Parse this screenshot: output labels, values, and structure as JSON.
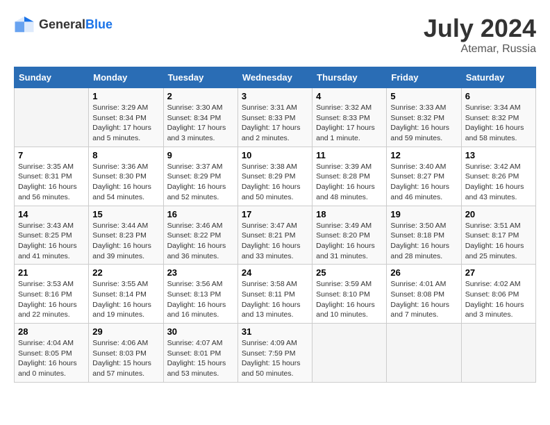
{
  "header": {
    "logo_general": "General",
    "logo_blue": "Blue",
    "month_year": "July 2024",
    "location": "Atemar, Russia"
  },
  "columns": [
    "Sunday",
    "Monday",
    "Tuesday",
    "Wednesday",
    "Thursday",
    "Friday",
    "Saturday"
  ],
  "weeks": [
    [
      {
        "day": "",
        "sunrise": "",
        "sunset": "",
        "daylight": ""
      },
      {
        "day": "1",
        "sunrise": "Sunrise: 3:29 AM",
        "sunset": "Sunset: 8:34 PM",
        "daylight": "Daylight: 17 hours and 5 minutes."
      },
      {
        "day": "2",
        "sunrise": "Sunrise: 3:30 AM",
        "sunset": "Sunset: 8:34 PM",
        "daylight": "Daylight: 17 hours and 3 minutes."
      },
      {
        "day": "3",
        "sunrise": "Sunrise: 3:31 AM",
        "sunset": "Sunset: 8:33 PM",
        "daylight": "Daylight: 17 hours and 2 minutes."
      },
      {
        "day": "4",
        "sunrise": "Sunrise: 3:32 AM",
        "sunset": "Sunset: 8:33 PM",
        "daylight": "Daylight: 17 hours and 1 minute."
      },
      {
        "day": "5",
        "sunrise": "Sunrise: 3:33 AM",
        "sunset": "Sunset: 8:32 PM",
        "daylight": "Daylight: 16 hours and 59 minutes."
      },
      {
        "day": "6",
        "sunrise": "Sunrise: 3:34 AM",
        "sunset": "Sunset: 8:32 PM",
        "daylight": "Daylight: 16 hours and 58 minutes."
      }
    ],
    [
      {
        "day": "7",
        "sunrise": "Sunrise: 3:35 AM",
        "sunset": "Sunset: 8:31 PM",
        "daylight": "Daylight: 16 hours and 56 minutes."
      },
      {
        "day": "8",
        "sunrise": "Sunrise: 3:36 AM",
        "sunset": "Sunset: 8:30 PM",
        "daylight": "Daylight: 16 hours and 54 minutes."
      },
      {
        "day": "9",
        "sunrise": "Sunrise: 3:37 AM",
        "sunset": "Sunset: 8:29 PM",
        "daylight": "Daylight: 16 hours and 52 minutes."
      },
      {
        "day": "10",
        "sunrise": "Sunrise: 3:38 AM",
        "sunset": "Sunset: 8:29 PM",
        "daylight": "Daylight: 16 hours and 50 minutes."
      },
      {
        "day": "11",
        "sunrise": "Sunrise: 3:39 AM",
        "sunset": "Sunset: 8:28 PM",
        "daylight": "Daylight: 16 hours and 48 minutes."
      },
      {
        "day": "12",
        "sunrise": "Sunrise: 3:40 AM",
        "sunset": "Sunset: 8:27 PM",
        "daylight": "Daylight: 16 hours and 46 minutes."
      },
      {
        "day": "13",
        "sunrise": "Sunrise: 3:42 AM",
        "sunset": "Sunset: 8:26 PM",
        "daylight": "Daylight: 16 hours and 43 minutes."
      }
    ],
    [
      {
        "day": "14",
        "sunrise": "Sunrise: 3:43 AM",
        "sunset": "Sunset: 8:25 PM",
        "daylight": "Daylight: 16 hours and 41 minutes."
      },
      {
        "day": "15",
        "sunrise": "Sunrise: 3:44 AM",
        "sunset": "Sunset: 8:23 PM",
        "daylight": "Daylight: 16 hours and 39 minutes."
      },
      {
        "day": "16",
        "sunrise": "Sunrise: 3:46 AM",
        "sunset": "Sunset: 8:22 PM",
        "daylight": "Daylight: 16 hours and 36 minutes."
      },
      {
        "day": "17",
        "sunrise": "Sunrise: 3:47 AM",
        "sunset": "Sunset: 8:21 PM",
        "daylight": "Daylight: 16 hours and 33 minutes."
      },
      {
        "day": "18",
        "sunrise": "Sunrise: 3:49 AM",
        "sunset": "Sunset: 8:20 PM",
        "daylight": "Daylight: 16 hours and 31 minutes."
      },
      {
        "day": "19",
        "sunrise": "Sunrise: 3:50 AM",
        "sunset": "Sunset: 8:18 PM",
        "daylight": "Daylight: 16 hours and 28 minutes."
      },
      {
        "day": "20",
        "sunrise": "Sunrise: 3:51 AM",
        "sunset": "Sunset: 8:17 PM",
        "daylight": "Daylight: 16 hours and 25 minutes."
      }
    ],
    [
      {
        "day": "21",
        "sunrise": "Sunrise: 3:53 AM",
        "sunset": "Sunset: 8:16 PM",
        "daylight": "Daylight: 16 hours and 22 minutes."
      },
      {
        "day": "22",
        "sunrise": "Sunrise: 3:55 AM",
        "sunset": "Sunset: 8:14 PM",
        "daylight": "Daylight: 16 hours and 19 minutes."
      },
      {
        "day": "23",
        "sunrise": "Sunrise: 3:56 AM",
        "sunset": "Sunset: 8:13 PM",
        "daylight": "Daylight: 16 hours and 16 minutes."
      },
      {
        "day": "24",
        "sunrise": "Sunrise: 3:58 AM",
        "sunset": "Sunset: 8:11 PM",
        "daylight": "Daylight: 16 hours and 13 minutes."
      },
      {
        "day": "25",
        "sunrise": "Sunrise: 3:59 AM",
        "sunset": "Sunset: 8:10 PM",
        "daylight": "Daylight: 16 hours and 10 minutes."
      },
      {
        "day": "26",
        "sunrise": "Sunrise: 4:01 AM",
        "sunset": "Sunset: 8:08 PM",
        "daylight": "Daylight: 16 hours and 7 minutes."
      },
      {
        "day": "27",
        "sunrise": "Sunrise: 4:02 AM",
        "sunset": "Sunset: 8:06 PM",
        "daylight": "Daylight: 16 hours and 3 minutes."
      }
    ],
    [
      {
        "day": "28",
        "sunrise": "Sunrise: 4:04 AM",
        "sunset": "Sunset: 8:05 PM",
        "daylight": "Daylight: 16 hours and 0 minutes."
      },
      {
        "day": "29",
        "sunrise": "Sunrise: 4:06 AM",
        "sunset": "Sunset: 8:03 PM",
        "daylight": "Daylight: 15 hours and 57 minutes."
      },
      {
        "day": "30",
        "sunrise": "Sunrise: 4:07 AM",
        "sunset": "Sunset: 8:01 PM",
        "daylight": "Daylight: 15 hours and 53 minutes."
      },
      {
        "day": "31",
        "sunrise": "Sunrise: 4:09 AM",
        "sunset": "Sunset: 7:59 PM",
        "daylight": "Daylight: 15 hours and 50 minutes."
      },
      {
        "day": "",
        "sunrise": "",
        "sunset": "",
        "daylight": ""
      },
      {
        "day": "",
        "sunrise": "",
        "sunset": "",
        "daylight": ""
      },
      {
        "day": "",
        "sunrise": "",
        "sunset": "",
        "daylight": ""
      }
    ]
  ]
}
